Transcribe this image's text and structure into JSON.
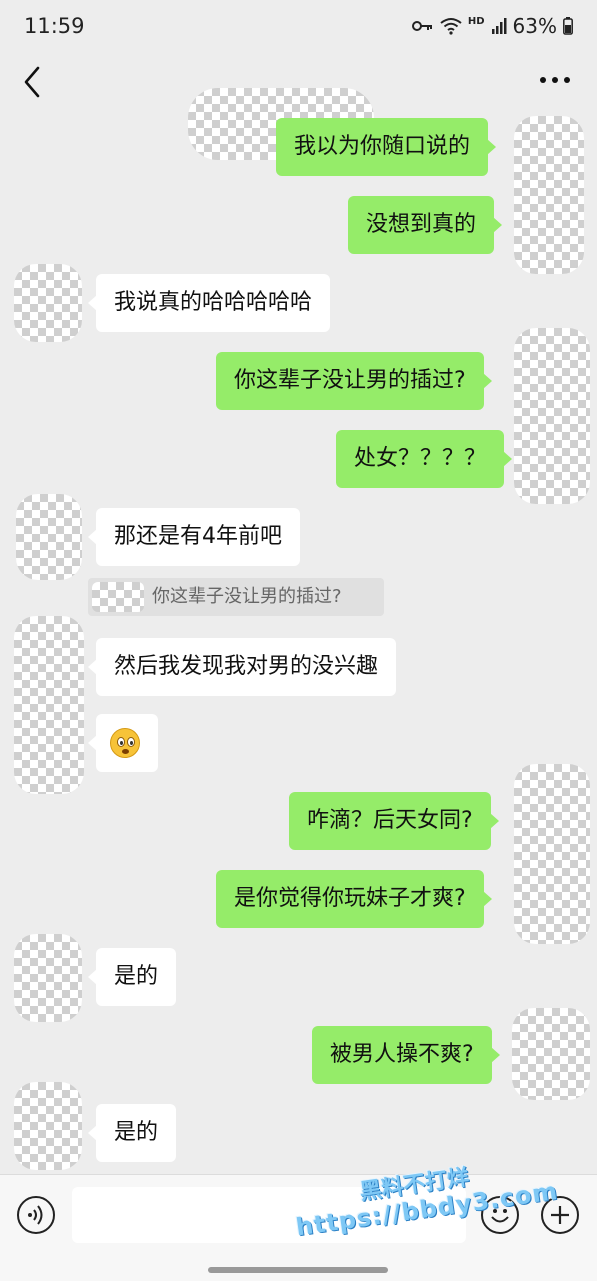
{
  "status_bar": {
    "time": "11:59",
    "network_label": "HD",
    "battery": "63%"
  },
  "header": {
    "back_icon": "back-arrow-icon",
    "more_icon": "more-dots-icon"
  },
  "messages": [
    {
      "sender": "me",
      "text": "我以为你随口说的"
    },
    {
      "sender": "me",
      "text": "没想到真的"
    },
    {
      "sender": "other",
      "text": "我说真的哈哈哈哈哈"
    },
    {
      "sender": "me",
      "text": "你这辈子没让男的插过?"
    },
    {
      "sender": "me",
      "text": "处女？？？？"
    },
    {
      "sender": "other",
      "text": "那还是有4年前吧"
    },
    {
      "sender": "quote",
      "text": "你这辈子没让男的插过?"
    },
    {
      "sender": "other",
      "text": "然后我发现我对男的没兴趣"
    },
    {
      "sender": "other",
      "emoji": "flushed-face-emoji"
    },
    {
      "sender": "me",
      "text": "咋滴？后天女同?"
    },
    {
      "sender": "me",
      "text": "是你觉得你玩妹子才爽?"
    },
    {
      "sender": "other",
      "text": "是的"
    },
    {
      "sender": "me",
      "text": "被男人操不爽?"
    },
    {
      "sender": "other",
      "text": "是的"
    }
  ],
  "input_bar": {
    "voice_icon": "voice-icon",
    "emoji_icon": "emoji-icon",
    "plus_icon": "plus-icon",
    "input_value": ""
  },
  "watermark": {
    "line1": "黑料不打烊",
    "line2": "https://bbdy3.com"
  },
  "colors": {
    "my_bubble": "#95ec69",
    "other_bubble": "#ffffff",
    "background": "#ededed"
  }
}
